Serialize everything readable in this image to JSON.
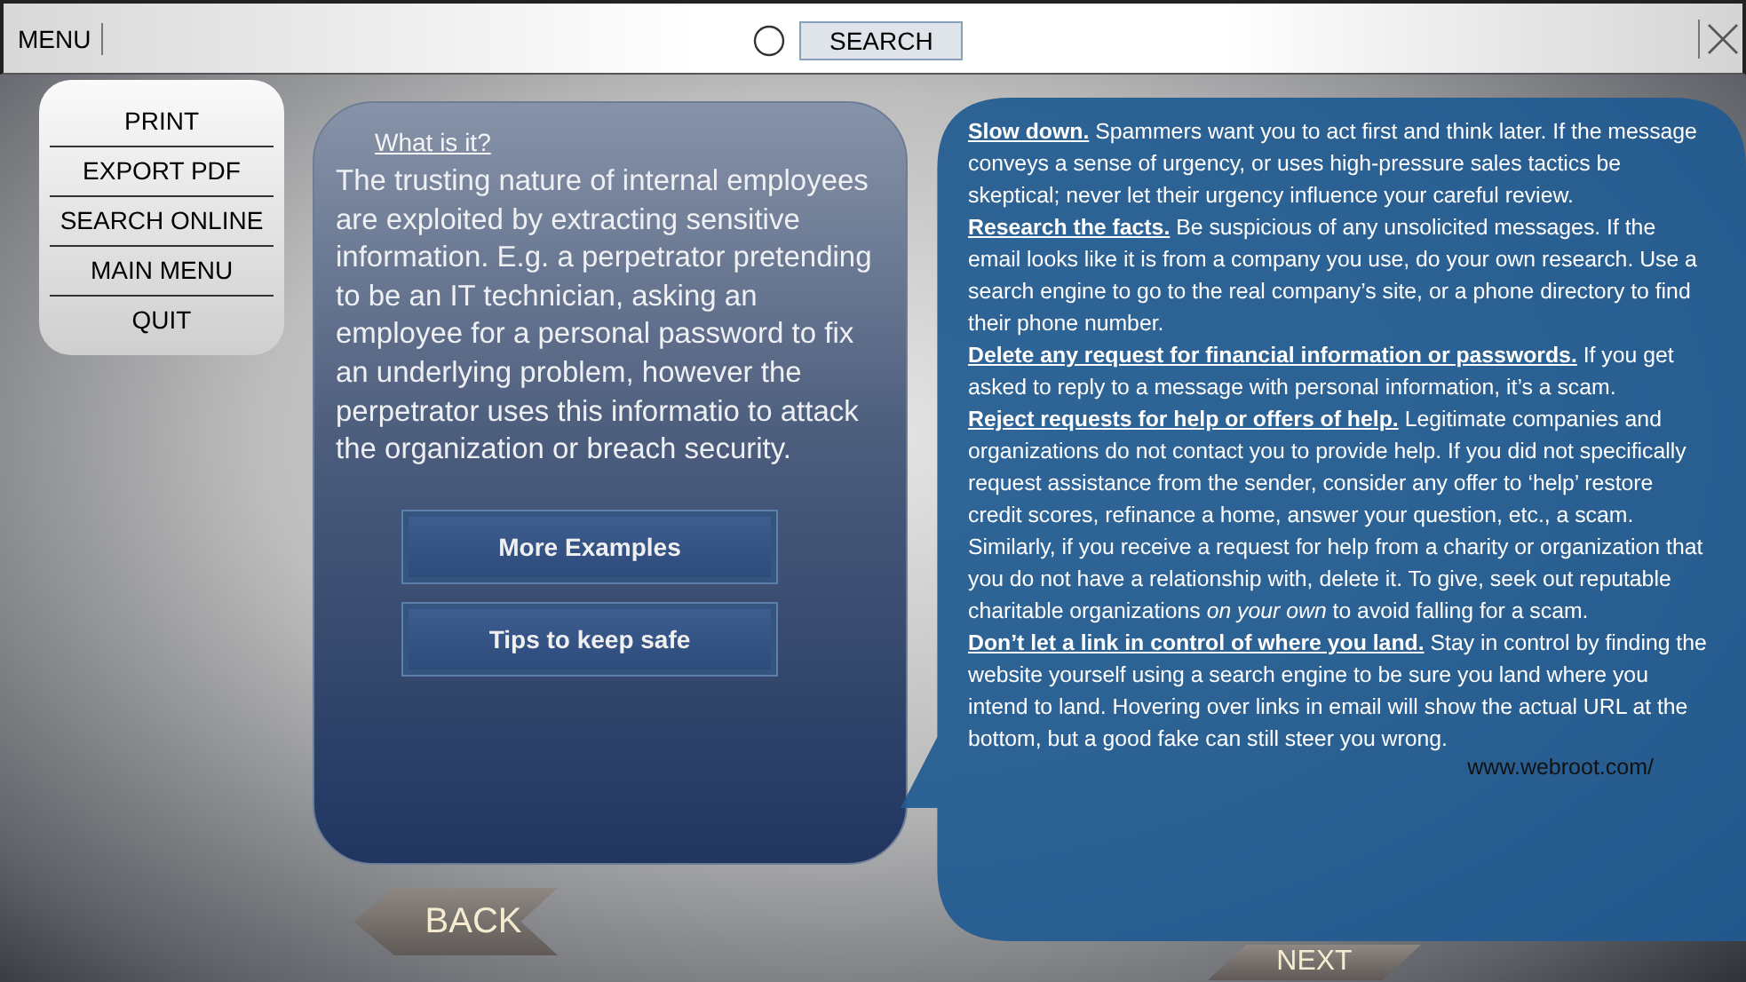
{
  "top_bar": {
    "menu_label": "MENU",
    "search_button": "SEARCH"
  },
  "side_menu": {
    "items": [
      "PRINT",
      "EXPORT PDF",
      "SEARCH ONLINE",
      "MAIN MENU",
      "QUIT"
    ]
  },
  "info_panel": {
    "heading": "What is it?",
    "body": "The trusting nature of internal employees are exploited by extracting sensitive information. E.g. a perpetrator pretending to be an IT technician, asking an employee for a personal password to fix an underlying problem, however the perpetrator uses this informatio to attack the organization or breach security.",
    "buttons": [
      "More Examples",
      "Tips to keep safe"
    ]
  },
  "tips_callout": {
    "tips": [
      {
        "title": "Slow down.",
        "text": "Spammers want you to act first and think later. If the message conveys a sense of urgency, or uses high-pressure sales tactics be skeptical; never let their urgency influence your careful review."
      },
      {
        "title": "Research the facts.",
        "text": "Be suspicious of any unsolicited messages. If the email looks like it is from a company you use, do your own research. Use a search engine to go to the real company’s site, or a phone directory to find their phone number."
      },
      {
        "title": "Delete any request for financial information or passwords.",
        "text": "If you get asked to reply to a message with personal information, it’s a scam."
      },
      {
        "title": "Reject requests for help or offers of help.",
        "text": "Legitimate companies and organizations do not contact you to provide help. If you did not specifically request assistance from the sender, consider any offer to ‘help’ restore credit scores, refinance a home, answer your question, etc., a scam. Similarly, if you receive a request for help from a charity or organization that you do not have a relationship with, delete it. To give, seek out reputable charitable organizations *on your own* to avoid falling for a scam."
      },
      {
        "title": "Don’t let a link in control of where you land.",
        "text": "Stay in control by finding the website yourself using a search engine to be sure you land where you intend to land. Hovering over links in email will show the actual URL at the bottom, but a good fake can still steer you wrong."
      }
    ],
    "source": "www.webroot.com/"
  },
  "navigation": {
    "back": "BACK",
    "next": "NEXT"
  }
}
